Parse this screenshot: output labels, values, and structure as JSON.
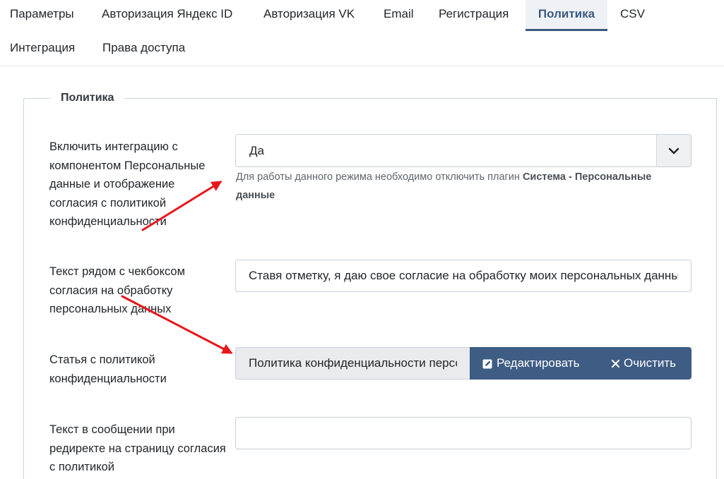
{
  "tabs": [
    {
      "label": "Параметры",
      "active": false
    },
    {
      "label": "Авторизация Яндекс ID",
      "active": false
    },
    {
      "label": "Авторизация VK",
      "active": false
    },
    {
      "label": "Email",
      "active": false
    },
    {
      "label": "Регистрация",
      "active": false
    },
    {
      "label": "Политика",
      "active": true
    },
    {
      "label": "CSV",
      "active": false
    },
    {
      "label": "Интеграция",
      "active": false
    },
    {
      "label": "Права доступа",
      "active": false
    }
  ],
  "fieldset": {
    "legend": "Политика"
  },
  "fields": {
    "integration": {
      "label": "Включить интеграцию с компонентом Персональные данные и отображение согласия с политикой конфиденциальности",
      "value": "Да",
      "hint_prefix": "Для работы данного режима необходимо отключить плагин",
      "hint_strong": "Система - Персональные данные"
    },
    "checkbox_text": {
      "label": "Текст рядом с чекбоксом согласия на обработку персональных данных",
      "value": "Ставя отметку, я даю свое согласие на обработку моих персональных данных"
    },
    "policy_article": {
      "label": "Статья с политикой конфиденциальности",
      "value": "Политика конфиденциальности персональных данных",
      "edit_label": "Редактировать",
      "clear_label": "Очистить"
    },
    "redirect_text": {
      "label": "Текст в сообщении при редиректе на страницу согласия с политикой",
      "value": ""
    }
  },
  "colors": {
    "accent": "#3e5c84",
    "annotation_arrow": "#e8161b"
  },
  "icons": {
    "select_caret": "chevron-down-icon",
    "edit": "pencil-square-icon",
    "clear": "close-icon"
  }
}
